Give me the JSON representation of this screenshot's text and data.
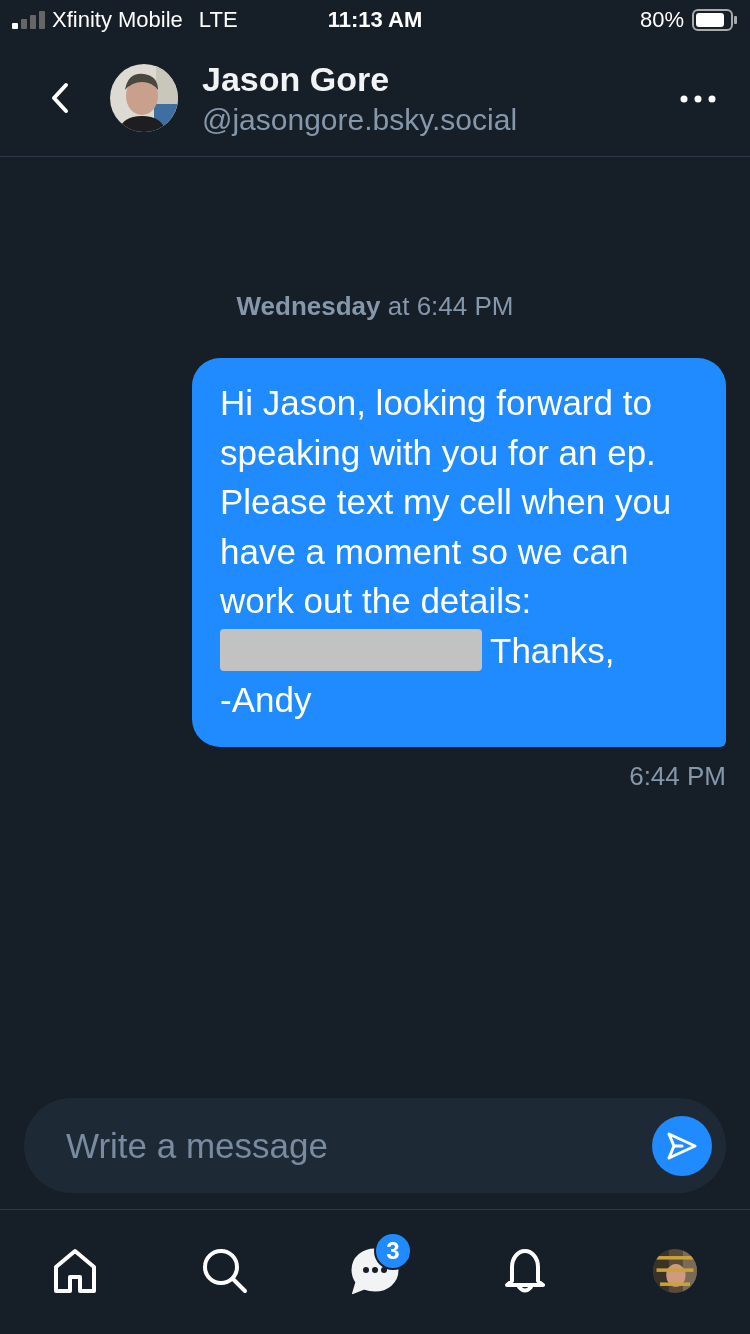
{
  "status_bar": {
    "carrier": "Xfinity Mobile",
    "network": "LTE",
    "time": "11:13 AM",
    "battery": "80%"
  },
  "header": {
    "name": "Jason Gore",
    "handle": "@jasongore.bsky.social"
  },
  "conversation": {
    "date_label": {
      "day": "Wednesday",
      "rest": "at 6:44 PM"
    },
    "messages": [
      {
        "kind": "sent",
        "text": "Hi Jason, looking forward to speaking with you for an ep. Please text my cell when you have a moment so we can work out the details:",
        "redacted": true,
        "signoff": "Thanks,",
        "signature": "-Andy",
        "time": "6:44 PM"
      }
    ]
  },
  "composer": {
    "placeholder": "Write a message"
  },
  "tab_bar": {
    "items": [
      {
        "kind": "home",
        "selected": false
      },
      {
        "kind": "search",
        "selected": false
      },
      {
        "kind": "chat",
        "selected": true,
        "badge": "3"
      },
      {
        "kind": "bell",
        "selected": false
      },
      {
        "kind": "avatar",
        "selected": false
      }
    ]
  }
}
